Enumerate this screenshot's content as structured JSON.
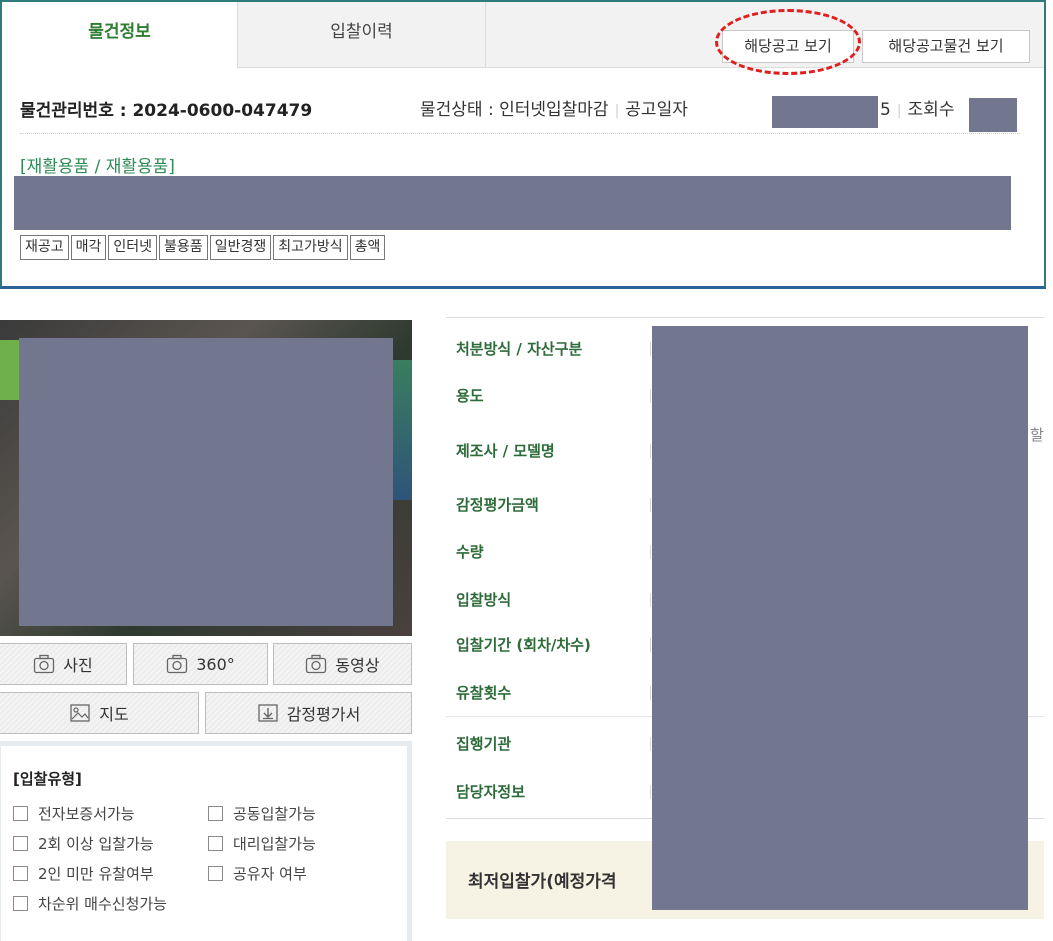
{
  "tabs": [
    {
      "label": "물건정보",
      "active": true
    },
    {
      "label": "입찰이력",
      "active": false
    }
  ],
  "header_buttons": {
    "notice_view": "해당공고 보기",
    "notice_items_view": "해당공고물건 보기"
  },
  "item": {
    "management_no": "물건관리번호 : 2024-0600-047479",
    "status": "물건상태 : 인터넷입찰마감",
    "notice_date_label": "공고일자",
    "notice_date_tail": "5",
    "views_label": "조회수",
    "category": "[재활용품 / 재활용품]",
    "tags": [
      "재공고",
      "매각",
      "인터넷",
      "불용품",
      "일반경쟁",
      "최고가방식",
      "총액"
    ]
  },
  "media_buttons": {
    "photo": "사진",
    "view360": "360°",
    "video": "동영상",
    "map": "지도",
    "appraisal": "감정평가서"
  },
  "bid_type": {
    "title": "[입찰유형]",
    "options": [
      "전자보증서가능",
      "공동입찰가능",
      "2회 이상 입찰가능",
      "대리입찰가능",
      "2인 미만 유찰여부",
      "공유자 여부",
      "차순위 매수신청가능"
    ]
  },
  "details": {
    "labels": [
      "처분방식 / 자산구분",
      "용도",
      "제조사 / 모델명",
      "감정평가금액",
      "수량",
      "입찰방식",
      "입찰기간 (회차/차수)",
      "유찰횟수",
      "집행기관",
      "담당자정보"
    ],
    "edge_glyph": "할"
  },
  "min_bid": {
    "label": "최저입찰가(예정가격"
  },
  "colors": {
    "tab_active": "#2e7d32",
    "label_green": "#2e6b3a",
    "category": "#2e8b57",
    "annotation_red": "#e01e1e",
    "redaction": "#72778f"
  }
}
